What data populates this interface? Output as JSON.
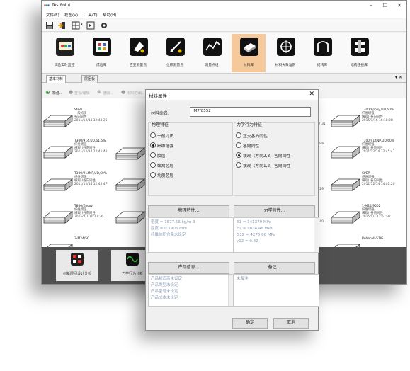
{
  "app": {
    "title": "TestPoint",
    "window_controls": [
      "–",
      "☐",
      "✕"
    ]
  },
  "menu": [
    "文件(E)",
    "视图(V)",
    "工具(T)",
    "帮助(H)"
  ],
  "ribbon": [
    {
      "label": "试验实时监控",
      "icon": "monitor-icon"
    },
    {
      "label": "试验库",
      "icon": "library-icon"
    },
    {
      "label": "应变测量点",
      "icon": "strain-point-icon"
    },
    {
      "label": "位移测量点",
      "icon": "displacement-point-icon"
    },
    {
      "label": "测量点组",
      "icon": "point-group-icon"
    },
    {
      "label": "材料库",
      "icon": "material-icon",
      "selected": true
    },
    {
      "label": "材料失效准则",
      "icon": "failure-criterion-icon"
    },
    {
      "label": "结构库",
      "icon": "structure-icon"
    },
    {
      "label": "结构连接库",
      "icon": "connection-icon"
    }
  ],
  "tabs": [
    "基本材料",
    "层压板"
  ],
  "toolbar2": [
    "新建..",
    "查看/编辑",
    "删除..",
    "材料导出.."
  ],
  "materials_left": [
    {
      "name": "Steel",
      "lines": [
        "一般均质",
        "各向同性",
        "2011/12/14 12:43:26"
      ]
    },
    {
      "name": "T300/914,UD,61.5%",
      "lines": [
        "纤维增强",
        "横观()各向同性",
        "2011/12/14 12:45:40"
      ]
    },
    {
      "name": "T300/914NP,UD,60%",
      "lines": [
        "纤维增强",
        "横观()各向同性",
        "2011/12/14 12:45:47"
      ]
    },
    {
      "name": "T800/Epoxy",
      "lines": [
        "纤维增强",
        "横观()各向同性",
        "2015/4/7 10:17:36"
      ]
    },
    {
      "name": "3-M24/50",
      "lines": []
    }
  ],
  "materials_right": [
    {
      "name": "T300/Epoxy,UD,60%",
      "lines": [
        "纤维增强",
        "横观()各向同性",
        "2015/1/16 16:18:20"
      ]
    },
    {
      "name": "T300/914NP,UD,60%",
      "lines": [
        "纤维增强",
        "横观()各向同性",
        "2011/12/14 12:45:47"
      ]
    },
    {
      "name": "CPEP",
      "lines": [
        "纤维增强",
        "横观()各向同性",
        "2011/12/14 14:01:20"
      ]
    },
    {
      "name": "1-M24/9502",
      "lines": [
        "纤维增强",
        "横观()各向同性",
        "2015/4/7 12:57:37"
      ]
    },
    {
      "name": "Rohacell-51IG",
      "lines": []
    }
  ],
  "middle_fragments": [
    "47:31",
    ",59%",
    "5:29",
    "6:40"
  ],
  "bottom_panel": [
    {
      "label": "创新层间设计分析",
      "icon": "design-analysis-icon"
    },
    {
      "label": "力学行为分析",
      "icon": "mechanics-analysis-icon"
    }
  ],
  "dialog": {
    "title": "材料属性",
    "close": "✕",
    "name_label": "材料命名:",
    "name_value": "IM7/8552",
    "physical_group": "物理特征",
    "physical_options": [
      "一般均质",
      "纤维增强",
      "胶层",
      "蜂窝芯层",
      "均质芯层"
    ],
    "physical_selected_index": 1,
    "mechanical_group": "力学行为特征",
    "mechanical_options": [
      "正交各向同性",
      "各向同性",
      "横观（方向2,3）各向同性",
      "横观（方向1,2）各向同性"
    ],
    "mechanical_selected_index": 2,
    "physical_button": "物理特性...",
    "mechanical_button": "力学特性...",
    "physical_props": [
      "密度 = 1577.56 kg/m 3",
      "厚度 = 0.1905 mm",
      "纤维体积含量未设定"
    ],
    "mechanical_props": [
      "E1 = 141379 MPa",
      "E2 = 9034.48 MPa",
      "G12 = 4275.86 MPa",
      "v12 = 0.32"
    ],
    "product_button": "产品信息...",
    "notes_button": "备注...",
    "product_props": [
      "产品制造商未设定",
      "产品类型未设定",
      "产品型号未设定",
      "产品成本未设定"
    ],
    "notes_text": "未备注",
    "ok": "确定",
    "cancel": "取消"
  }
}
